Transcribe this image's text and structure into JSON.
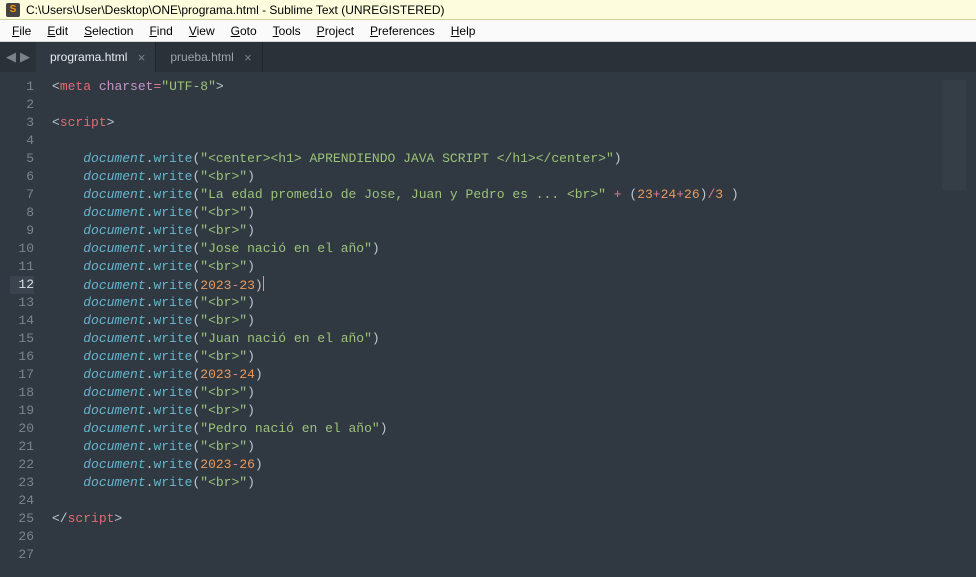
{
  "window_title": "C:\\Users\\User\\Desktop\\ONE\\programa.html - Sublime Text (UNREGISTERED)",
  "menu": [
    "File",
    "Edit",
    "Selection",
    "Find",
    "View",
    "Goto",
    "Tools",
    "Project",
    "Preferences",
    "Help"
  ],
  "tabs": {
    "nav_back": "◀",
    "nav_fwd": "▶",
    "items": [
      {
        "label": "programa.html",
        "active": true
      },
      {
        "label": "prueba.html",
        "active": false
      }
    ]
  },
  "editor": {
    "current_line": 12,
    "lines": [
      {
        "n": 1,
        "seg": [
          [
            "pun",
            "<"
          ],
          [
            "tag",
            "meta"
          ],
          [
            "pun",
            " "
          ],
          [
            "attr",
            "charset"
          ],
          [
            "op",
            "="
          ],
          [
            "str",
            "\"UTF-8\""
          ],
          [
            "pun",
            ">"
          ]
        ]
      },
      {
        "n": 2,
        "seg": []
      },
      {
        "n": 3,
        "seg": [
          [
            "pun",
            "<"
          ],
          [
            "tag",
            "script"
          ],
          [
            "pun",
            ">"
          ]
        ]
      },
      {
        "n": 4,
        "seg": []
      },
      {
        "n": 5,
        "seg": [
          [
            "pun",
            "    "
          ],
          [
            "obj",
            "document"
          ],
          [
            "pun",
            "."
          ],
          [
            "fn",
            "write"
          ],
          [
            "pun",
            "("
          ],
          [
            "str",
            "\"<center><h1> APRENDIENDO JAVA SCRIPT </h1></center>\""
          ],
          [
            "pun",
            ")"
          ]
        ]
      },
      {
        "n": 6,
        "seg": [
          [
            "pun",
            "    "
          ],
          [
            "obj",
            "document"
          ],
          [
            "pun",
            "."
          ],
          [
            "fn",
            "write"
          ],
          [
            "pun",
            "("
          ],
          [
            "str",
            "\"<br>\""
          ],
          [
            "pun",
            ")"
          ]
        ]
      },
      {
        "n": 7,
        "seg": [
          [
            "pun",
            "    "
          ],
          [
            "obj",
            "document"
          ],
          [
            "pun",
            "."
          ],
          [
            "fn",
            "write"
          ],
          [
            "pun",
            "("
          ],
          [
            "str",
            "\"La edad promedio de Jose, Juan y Pedro es ... <br>\""
          ],
          [
            "pun",
            " "
          ],
          [
            "op",
            "+"
          ],
          [
            "pun",
            " ("
          ],
          [
            "num",
            "23"
          ],
          [
            "op",
            "+"
          ],
          [
            "num",
            "24"
          ],
          [
            "op",
            "+"
          ],
          [
            "num",
            "26"
          ],
          [
            "pun",
            ")"
          ],
          [
            "op",
            "/"
          ],
          [
            "num",
            "3"
          ],
          [
            "pun",
            " )"
          ]
        ]
      },
      {
        "n": 8,
        "seg": [
          [
            "pun",
            "    "
          ],
          [
            "obj",
            "document"
          ],
          [
            "pun",
            "."
          ],
          [
            "fn",
            "write"
          ],
          [
            "pun",
            "("
          ],
          [
            "str",
            "\"<br>\""
          ],
          [
            "pun",
            ")"
          ]
        ]
      },
      {
        "n": 9,
        "seg": [
          [
            "pun",
            "    "
          ],
          [
            "obj",
            "document"
          ],
          [
            "pun",
            "."
          ],
          [
            "fn",
            "write"
          ],
          [
            "pun",
            "("
          ],
          [
            "str",
            "\"<br>\""
          ],
          [
            "pun",
            ")"
          ]
        ]
      },
      {
        "n": 10,
        "seg": [
          [
            "pun",
            "    "
          ],
          [
            "obj",
            "document"
          ],
          [
            "pun",
            "."
          ],
          [
            "fn",
            "write"
          ],
          [
            "pun",
            "("
          ],
          [
            "str",
            "\"Jose nació en el año\""
          ],
          [
            "pun",
            ")"
          ]
        ]
      },
      {
        "n": 11,
        "seg": [
          [
            "pun",
            "    "
          ],
          [
            "obj",
            "document"
          ],
          [
            "pun",
            "."
          ],
          [
            "fn",
            "write"
          ],
          [
            "pun",
            "("
          ],
          [
            "str",
            "\"<br>\""
          ],
          [
            "pun",
            ")"
          ]
        ]
      },
      {
        "n": 12,
        "seg": [
          [
            "pun",
            "    "
          ],
          [
            "obj",
            "document"
          ],
          [
            "pun",
            "."
          ],
          [
            "fn",
            "write"
          ],
          [
            "pun",
            "("
          ],
          [
            "num",
            "2023"
          ],
          [
            "op",
            "-"
          ],
          [
            "num",
            "23"
          ],
          [
            "pun",
            ")"
          ]
        ],
        "cursor_after": true
      },
      {
        "n": 13,
        "seg": [
          [
            "pun",
            "    "
          ],
          [
            "obj",
            "document"
          ],
          [
            "pun",
            "."
          ],
          [
            "fn",
            "write"
          ],
          [
            "pun",
            "("
          ],
          [
            "str",
            "\"<br>\""
          ],
          [
            "pun",
            ")"
          ]
        ]
      },
      {
        "n": 14,
        "seg": [
          [
            "pun",
            "    "
          ],
          [
            "obj",
            "document"
          ],
          [
            "pun",
            "."
          ],
          [
            "fn",
            "write"
          ],
          [
            "pun",
            "("
          ],
          [
            "str",
            "\"<br>\""
          ],
          [
            "pun",
            ")"
          ]
        ]
      },
      {
        "n": 15,
        "seg": [
          [
            "pun",
            "    "
          ],
          [
            "obj",
            "document"
          ],
          [
            "pun",
            "."
          ],
          [
            "fn",
            "write"
          ],
          [
            "pun",
            "("
          ],
          [
            "str",
            "\"Juan nació en el año\""
          ],
          [
            "pun",
            ")"
          ]
        ]
      },
      {
        "n": 16,
        "seg": [
          [
            "pun",
            "    "
          ],
          [
            "obj",
            "document"
          ],
          [
            "pun",
            "."
          ],
          [
            "fn",
            "write"
          ],
          [
            "pun",
            "("
          ],
          [
            "str",
            "\"<br>\""
          ],
          [
            "pun",
            ")"
          ]
        ]
      },
      {
        "n": 17,
        "seg": [
          [
            "pun",
            "    "
          ],
          [
            "obj",
            "document"
          ],
          [
            "pun",
            "."
          ],
          [
            "fn",
            "write"
          ],
          [
            "pun",
            "("
          ],
          [
            "num",
            "2023"
          ],
          [
            "op",
            "-"
          ],
          [
            "num",
            "24"
          ],
          [
            "pun",
            ")"
          ]
        ]
      },
      {
        "n": 18,
        "seg": [
          [
            "pun",
            "    "
          ],
          [
            "obj",
            "document"
          ],
          [
            "pun",
            "."
          ],
          [
            "fn",
            "write"
          ],
          [
            "pun",
            "("
          ],
          [
            "str",
            "\"<br>\""
          ],
          [
            "pun",
            ")"
          ]
        ]
      },
      {
        "n": 19,
        "seg": [
          [
            "pun",
            "    "
          ],
          [
            "obj",
            "document"
          ],
          [
            "pun",
            "."
          ],
          [
            "fn",
            "write"
          ],
          [
            "pun",
            "("
          ],
          [
            "str",
            "\"<br>\""
          ],
          [
            "pun",
            ")"
          ]
        ]
      },
      {
        "n": 20,
        "seg": [
          [
            "pun",
            "    "
          ],
          [
            "obj",
            "document"
          ],
          [
            "pun",
            "."
          ],
          [
            "fn",
            "write"
          ],
          [
            "pun",
            "("
          ],
          [
            "str",
            "\"Pedro nació en el año\""
          ],
          [
            "pun",
            ")"
          ]
        ]
      },
      {
        "n": 21,
        "seg": [
          [
            "pun",
            "    "
          ],
          [
            "obj",
            "document"
          ],
          [
            "pun",
            "."
          ],
          [
            "fn",
            "write"
          ],
          [
            "pun",
            "("
          ],
          [
            "str",
            "\"<br>\""
          ],
          [
            "pun",
            ")"
          ]
        ]
      },
      {
        "n": 22,
        "seg": [
          [
            "pun",
            "    "
          ],
          [
            "obj",
            "document"
          ],
          [
            "pun",
            "."
          ],
          [
            "fn",
            "write"
          ],
          [
            "pun",
            "("
          ],
          [
            "num",
            "2023"
          ],
          [
            "op",
            "-"
          ],
          [
            "num",
            "26"
          ],
          [
            "pun",
            ")"
          ]
        ]
      },
      {
        "n": 23,
        "seg": [
          [
            "pun",
            "    "
          ],
          [
            "obj",
            "document"
          ],
          [
            "pun",
            "."
          ],
          [
            "fn",
            "write"
          ],
          [
            "pun",
            "("
          ],
          [
            "str",
            "\"<br>\""
          ],
          [
            "pun",
            ")"
          ]
        ]
      },
      {
        "n": 24,
        "seg": []
      },
      {
        "n": 25,
        "seg": [
          [
            "pun",
            "</"
          ],
          [
            "tag",
            "script"
          ],
          [
            "pun",
            ">"
          ]
        ]
      },
      {
        "n": 26,
        "seg": []
      },
      {
        "n": 27,
        "seg": []
      }
    ]
  }
}
